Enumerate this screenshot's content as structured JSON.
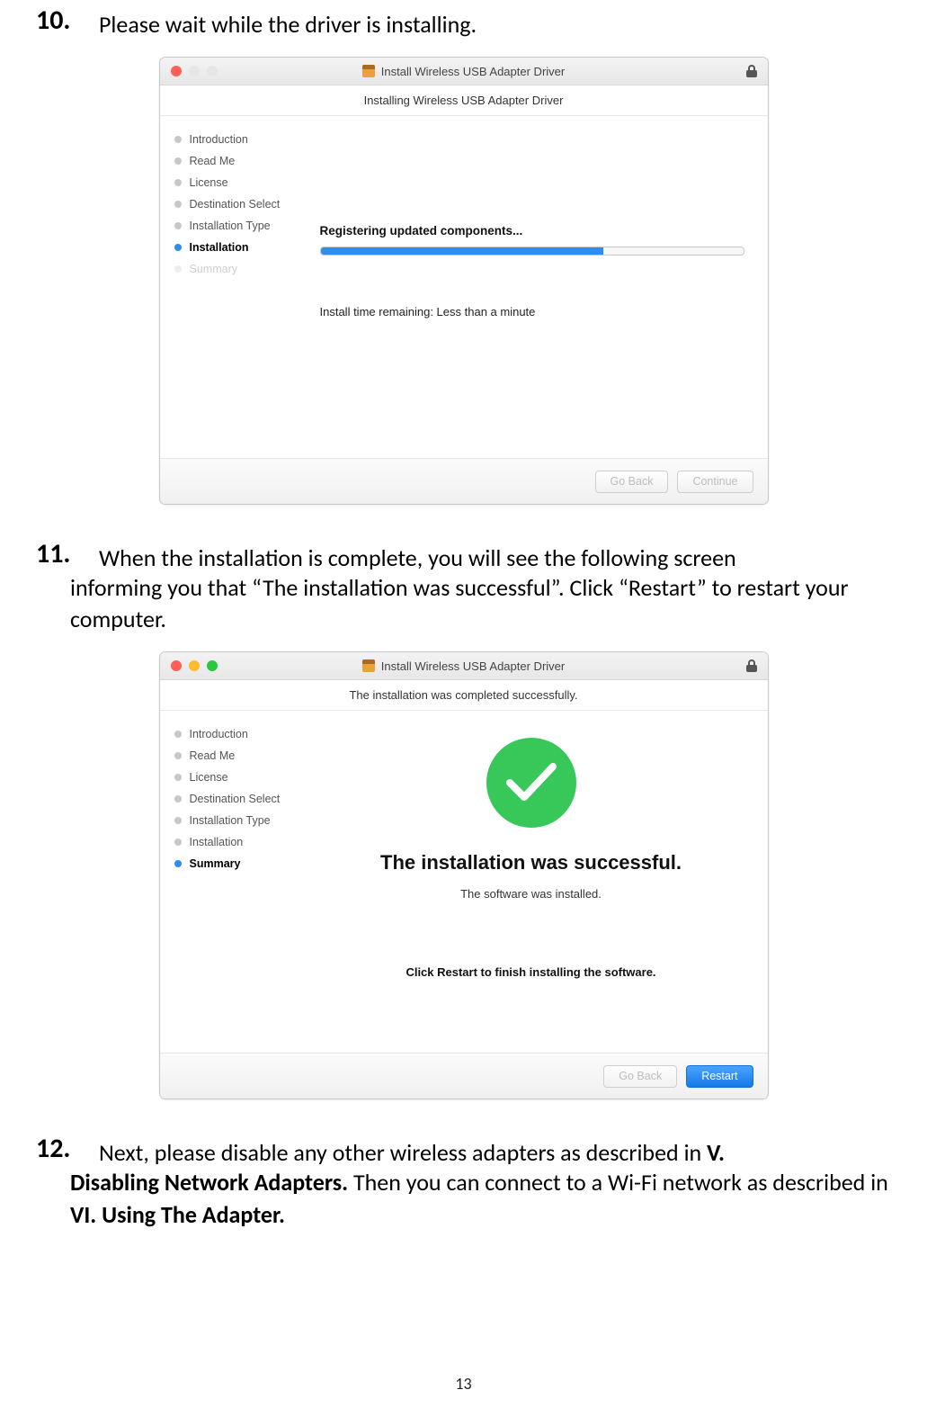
{
  "page_number": "13",
  "steps": {
    "s10": {
      "num": "10.",
      "text": "Please wait while the driver is installing."
    },
    "s11": {
      "num": "11.",
      "text_line1": "When the installation is complete, you will see the following screen",
      "text_cont": "informing you that “The installation was successful”. Click “Restart” to restart your computer."
    },
    "s12": {
      "num": "12.",
      "text_pre": "Next, please disable any other wireless adapters as described in ",
      "bold1": "V.",
      "cont1_bold": "Disabling Network Adapters.",
      "cont1_rest": " Then you can connect to a Wi-Fi network as described in ",
      "cont1_bold2": "VI. Using The Adapter."
    }
  },
  "win1": {
    "title": "Install Wireless USB Adapter Driver",
    "subheader": "Installing Wireless USB Adapter Driver",
    "sidebar": {
      "s0": "Introduction",
      "s1": "Read Me",
      "s2": "License",
      "s3": "Destination Select",
      "s4": "Installation Type",
      "s5": "Installation",
      "s6": "Summary"
    },
    "status": "Registering updated components...",
    "time_remaining": "Install time remaining: Less than a minute",
    "btn_back": "Go Back",
    "btn_continue": "Continue",
    "traffic": {
      "close": "#ff5f57",
      "min": "#ffbd2e",
      "max": "#28c840"
    },
    "progress_pct": 67
  },
  "win2": {
    "title": "Install Wireless USB Adapter Driver",
    "subheader": "The installation was completed successfully.",
    "sidebar": {
      "s0": "Introduction",
      "s1": "Read Me",
      "s2": "License",
      "s3": "Destination Select",
      "s4": "Installation Type",
      "s5": "Installation",
      "s6": "Summary"
    },
    "success_title": "The installation was successful.",
    "success_sub": "The software was installed.",
    "success_footer": "Click Restart to finish installing the software.",
    "btn_back": "Go Back",
    "btn_restart": "Restart",
    "traffic": {
      "close": "#ff5f57",
      "min": "#ffbd2e",
      "max": "#28c840"
    }
  }
}
